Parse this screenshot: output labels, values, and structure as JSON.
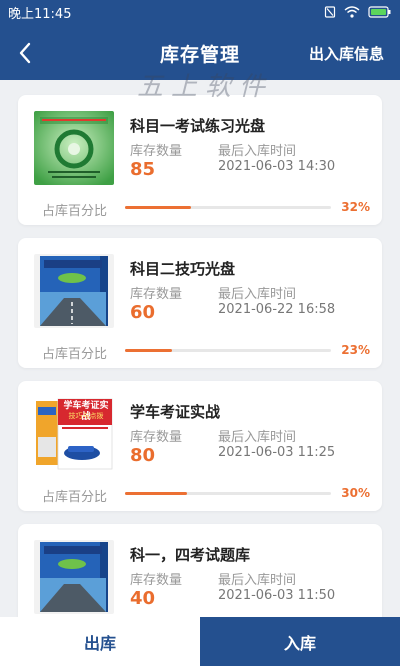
{
  "status_bar": {
    "time": "晚上11:45",
    "icons": [
      "sim-icon",
      "wifi-icon",
      "battery-icon"
    ]
  },
  "header": {
    "title": "库存管理",
    "right_link": "出入库信息",
    "back_icon": "back-arrow-icon",
    "watermark": "五上软件"
  },
  "labels": {
    "qty": "库存数量",
    "last_in": "最后入库时间",
    "percent": "占库百分比"
  },
  "items": [
    {
      "name": "科目一考试练习光盘",
      "qty": "85",
      "last_in": "2021-06-03 14:30",
      "percent": "32%",
      "fill": 0.32,
      "thumb": "green-disc-cover-image"
    },
    {
      "name": "科目二技巧光盘",
      "qty": "60",
      "last_in": "2021-06-22 16:58",
      "percent": "23%",
      "fill": 0.23,
      "thumb": "blue-box-cover-image"
    },
    {
      "name": "学车考证实战",
      "qty": "80",
      "last_in": "2021-06-03 11:25",
      "percent": "30%",
      "fill": 0.3,
      "thumb": "red-book-cover-image"
    },
    {
      "name": "科一，四考试题库",
      "qty": "40",
      "last_in": "2021-06-03 11:50",
      "percent": "",
      "fill": 0.0,
      "thumb": "blue-box-cover-image"
    }
  ],
  "book_cover": {
    "title": "学车考证实战",
    "subtitle": "技巧与点拨"
  },
  "tabs": {
    "out": "出库",
    "in": "入库"
  },
  "colors": {
    "primary": "#24508f",
    "accent": "#ec7033",
    "background": "#eef0f3"
  }
}
